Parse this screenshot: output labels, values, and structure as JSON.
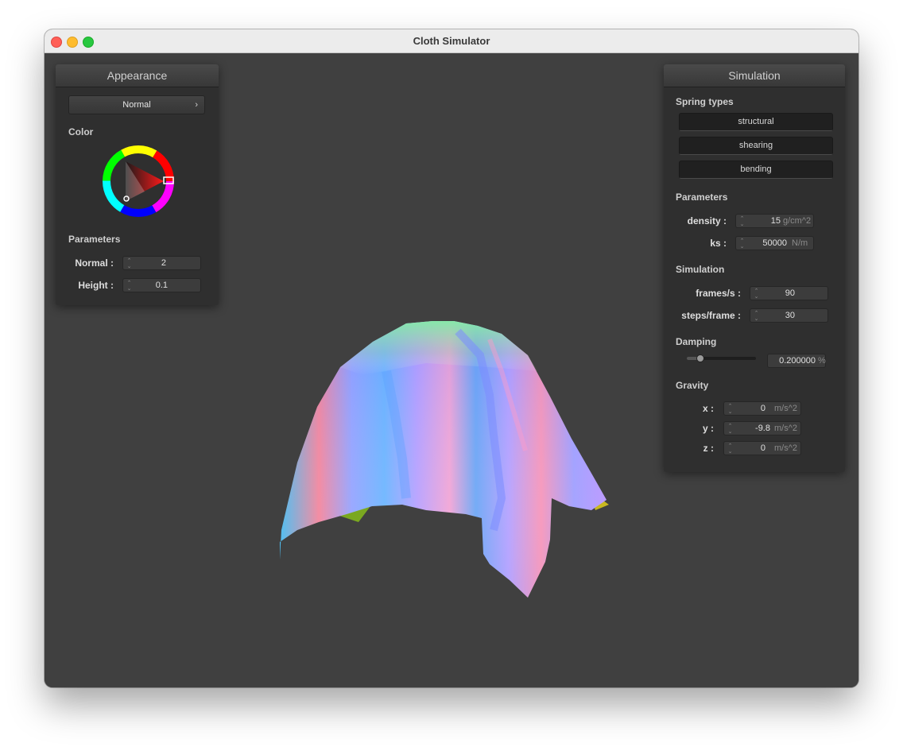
{
  "window": {
    "title": "Cloth Simulator"
  },
  "appearance": {
    "header": "Appearance",
    "shader_selected": "Normal",
    "color_label": "Color",
    "parameters_label": "Parameters",
    "normal_label": "Normal :",
    "normal_value": "2",
    "height_label": "Height :",
    "height_value": "0.1",
    "selected_color": "#ff0000"
  },
  "simulation": {
    "header": "Simulation",
    "spring_types_label": "Spring types",
    "spring_types": [
      "structural",
      "shearing",
      "bending"
    ],
    "parameters_label": "Parameters",
    "density_label": "density :",
    "density_value": "15",
    "density_unit": "g/cm^2",
    "ks_label": "ks :",
    "ks_value": "50000",
    "ks_unit": "N/m",
    "simulation_label": "Simulation",
    "fps_label": "frames/s :",
    "fps_value": "90",
    "steps_label": "steps/frame :",
    "steps_value": "30",
    "damping_label": "Damping",
    "damping_value": "0.200000",
    "damping_unit": "%",
    "damping_fraction": 0.2,
    "gravity_label": "Gravity",
    "gx_label": "x :",
    "gx_value": "0",
    "gy_label": "y :",
    "gy_value": "-9.8",
    "gz_label": "z :",
    "gz_value": "0",
    "g_unit": "m/s^2"
  }
}
